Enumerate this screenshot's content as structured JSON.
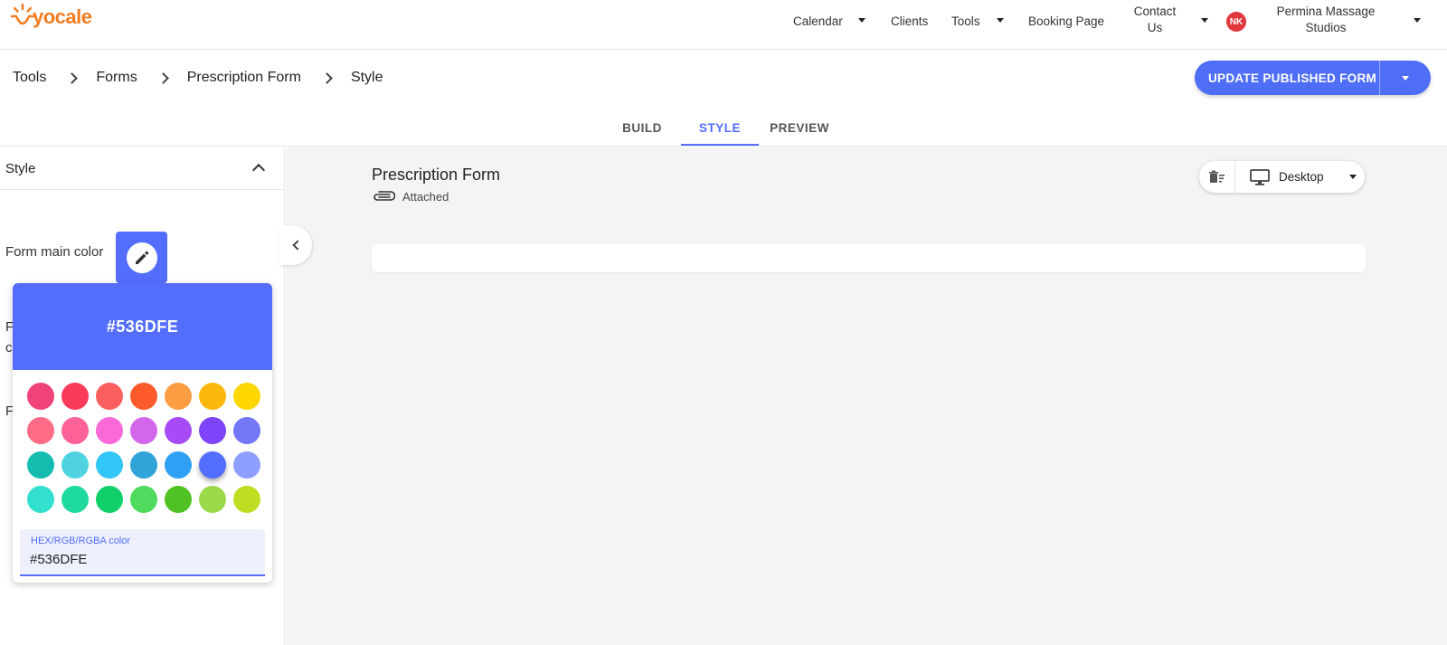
{
  "nav": {
    "logo_text": "yocale",
    "items": [
      {
        "label": "Calendar"
      },
      {
        "label": "Clients"
      },
      {
        "label": "Tools"
      },
      {
        "label": "Booking Page"
      }
    ],
    "contact_label": "Contact Us",
    "avatar_initials": "NK",
    "studio_name": "Permina Massage Studios"
  },
  "breadcrumb": [
    "Tools",
    "Forms",
    "Prescription Form",
    "Style"
  ],
  "publish_button": {
    "label": "UPDATE PUBLISHED FORM"
  },
  "tabs": [
    {
      "label": "BUILD",
      "active": false
    },
    {
      "label": "STYLE",
      "active": true
    },
    {
      "label": "PREVIEW",
      "active": false
    }
  ],
  "style_panel": {
    "title": "Style",
    "main_color_label": "Form main color",
    "hidden_label_1a": "F",
    "hidden_label_1b": "c",
    "hidden_label_2": "F"
  },
  "color_picker": {
    "current": "#536DFE",
    "input_label": "HEX/RGB/RGBA color",
    "input_value": "#536DFE",
    "swatches": [
      "#f0437a",
      "#fb3b5a",
      "#fd5e5e",
      "#fc5a2c",
      "#fd9d44",
      "#fdb90b",
      "#fed703",
      "#fd6b86",
      "#fc6197",
      "#fb69d9",
      "#d367ec",
      "#a64bf5",
      "#7d44f9",
      "#7478f8",
      "#15bdb0",
      "#50d3e1",
      "#31c6f7",
      "#30a3d8",
      "#2fa0f3",
      "#536dfe",
      "#8d9efe",
      "#33e0cf",
      "#1ed99e",
      "#11d06a",
      "#4edb5e",
      "#51c224",
      "#9ad94a",
      "#bfdd22"
    ],
    "selected": "#536dfe"
  },
  "form": {
    "title": "Prescription Form",
    "attached_label": "Attached"
  },
  "device_selector": {
    "label": "Desktop"
  }
}
